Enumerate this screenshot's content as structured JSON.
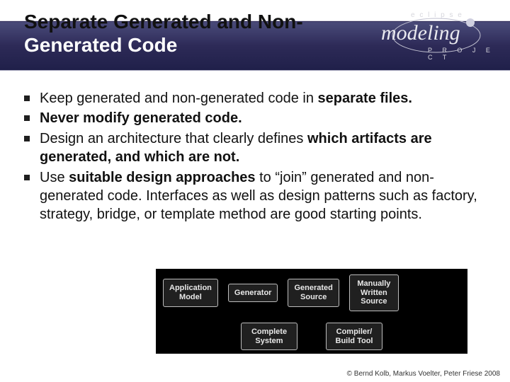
{
  "title_line1": "Separate Generated and Non-",
  "title_line2": "Generated Code",
  "logo": {
    "eclipse": "e c l i p s e",
    "modeling": "modeling",
    "project": "P R O J E C T"
  },
  "bullets": {
    "b1a": "Keep generated and non-generated code in ",
    "b1b": "separate files.",
    "b2a": "Never modify generated code.",
    "b3a": "Design an architecture that clearly defines ",
    "b3b": "which artifacts are generated, and which are not.",
    "b4a": "Use ",
    "b4b": "suitable design approaches",
    "b4c": " to “join” generated and non-generated code. Interfaces as well as design patterns such as factory, strategy, bridge, or template method are good starting points."
  },
  "diagram": {
    "r1": [
      "Application\nModel",
      "Generator",
      "Generated\nSource",
      "Manually\nWritten\nSource"
    ],
    "r2": [
      "Complete\nSystem",
      "Compiler/\nBuild Tool"
    ]
  },
  "footer": "© Bernd Kolb, Markus Voelter, Peter Friese 2008"
}
